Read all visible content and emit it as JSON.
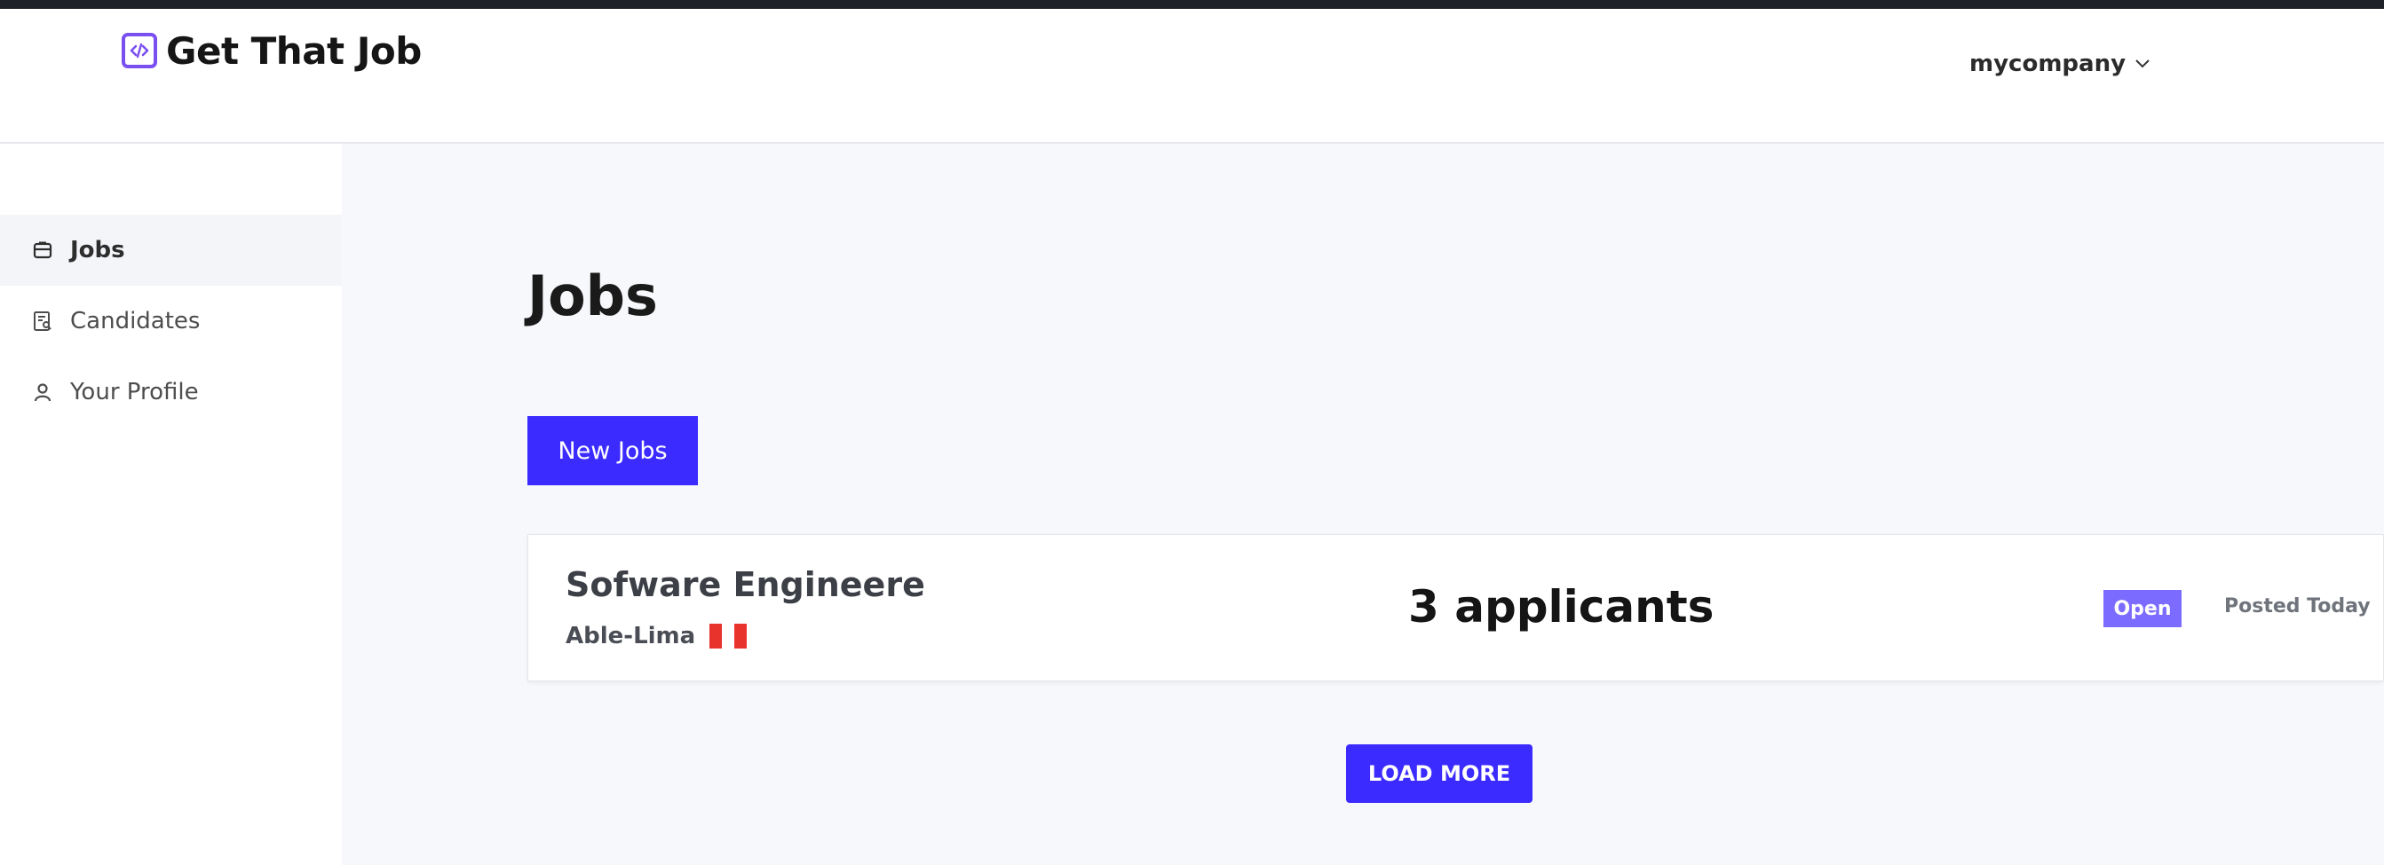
{
  "app": {
    "name": "Get That Job"
  },
  "account": {
    "name": "mycompany"
  },
  "sidebar": {
    "items": [
      {
        "label": "Jobs",
        "icon": "briefcase-icon",
        "active": true
      },
      {
        "label": "Candidates",
        "icon": "candidates-icon",
        "active": false
      },
      {
        "label": "Your Profile",
        "icon": "user-icon",
        "active": false
      }
    ]
  },
  "main": {
    "title": "Jobs",
    "new_jobs_label": "New Jobs",
    "load_more_label": "LOAD MORE",
    "jobs": [
      {
        "title": "Sofware Engineere",
        "location": "Able-Lima",
        "applicants": "3 applicants",
        "status": "Open",
        "posted": "Posted Today"
      }
    ]
  },
  "colors": {
    "accent": "#3b2bff",
    "badge": "#7b6cff",
    "logo": "#7a4ff0"
  }
}
